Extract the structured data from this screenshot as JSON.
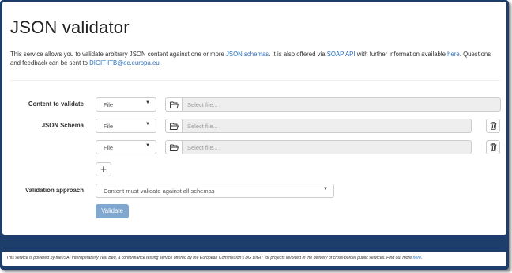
{
  "page": {
    "title": "JSON validator",
    "intro": {
      "part1": "This service allows you to validate arbitrary JSON content against one or more ",
      "link_schemas": "JSON schemas",
      "part2": ". It is also offered via ",
      "link_soap": "SOAP API",
      "part3": " with further information available ",
      "link_here": "here",
      "part4": ". Questions and feedback can be sent to ",
      "link_email": "DIGIT-ITB@ec.europa.eu",
      "part5": "."
    }
  },
  "form": {
    "content_label": "Content to validate",
    "content_source": "File",
    "content_placeholder": "Select file...",
    "schema_label": "JSON Schema",
    "schema_rows": [
      {
        "source": "File",
        "placeholder": "Select file..."
      },
      {
        "source": "File",
        "placeholder": "Select file..."
      }
    ],
    "add_label": "+",
    "approach_label": "Validation approach",
    "approach_value": "Content must validate against all schemas",
    "validate_label": "Validate"
  },
  "footer": {
    "text": "This service is powered by the ISA² Interoperability Test Bed, a conformance testing service offered by the European Commission's DG DIGIT for projects involved in the delivery of cross-border public services. Find out more ",
    "link": "here",
    "end": "."
  },
  "colors": {
    "frame": "#1d3d6b",
    "link": "#2a6eb8",
    "validate_button": "#7fa7cf",
    "file_input_bg": "#eeeeee"
  },
  "icons": {
    "caret": "caret-down-icon",
    "folder": "folder-open-icon",
    "delete": "trash-icon"
  }
}
